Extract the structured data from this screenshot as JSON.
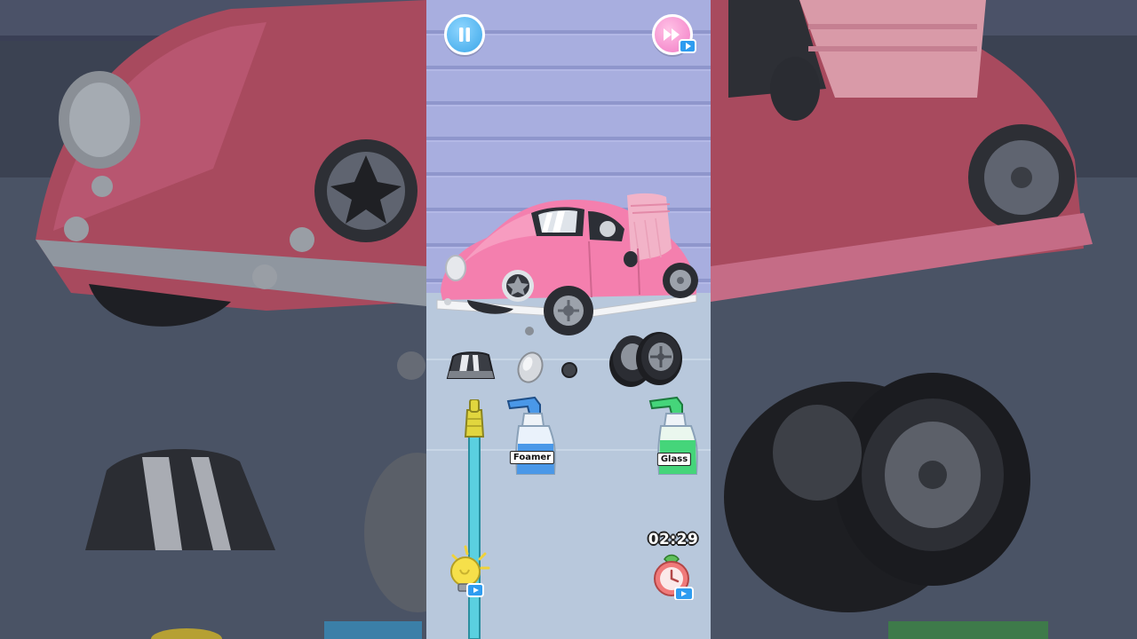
{
  "hud": {
    "pause_icon": "pause-icon",
    "skip_icon": "fast-forward-icon",
    "ad_icon": "video-ad-icon"
  },
  "tools": {
    "foamer_label": "Foamer",
    "glass_label": "Glass",
    "foamer_color": "#4a98e8",
    "glass_color": "#45d57a",
    "hose_color": "#5ad0e0"
  },
  "timer": {
    "value": "02:29",
    "icon": "stopwatch-icon"
  },
  "hint": {
    "icon": "lightbulb-icon"
  },
  "car": {
    "color": "#f47fae",
    "parts_removed": [
      "window-piece",
      "headlight-lens",
      "bolt",
      "tire-stack"
    ]
  }
}
